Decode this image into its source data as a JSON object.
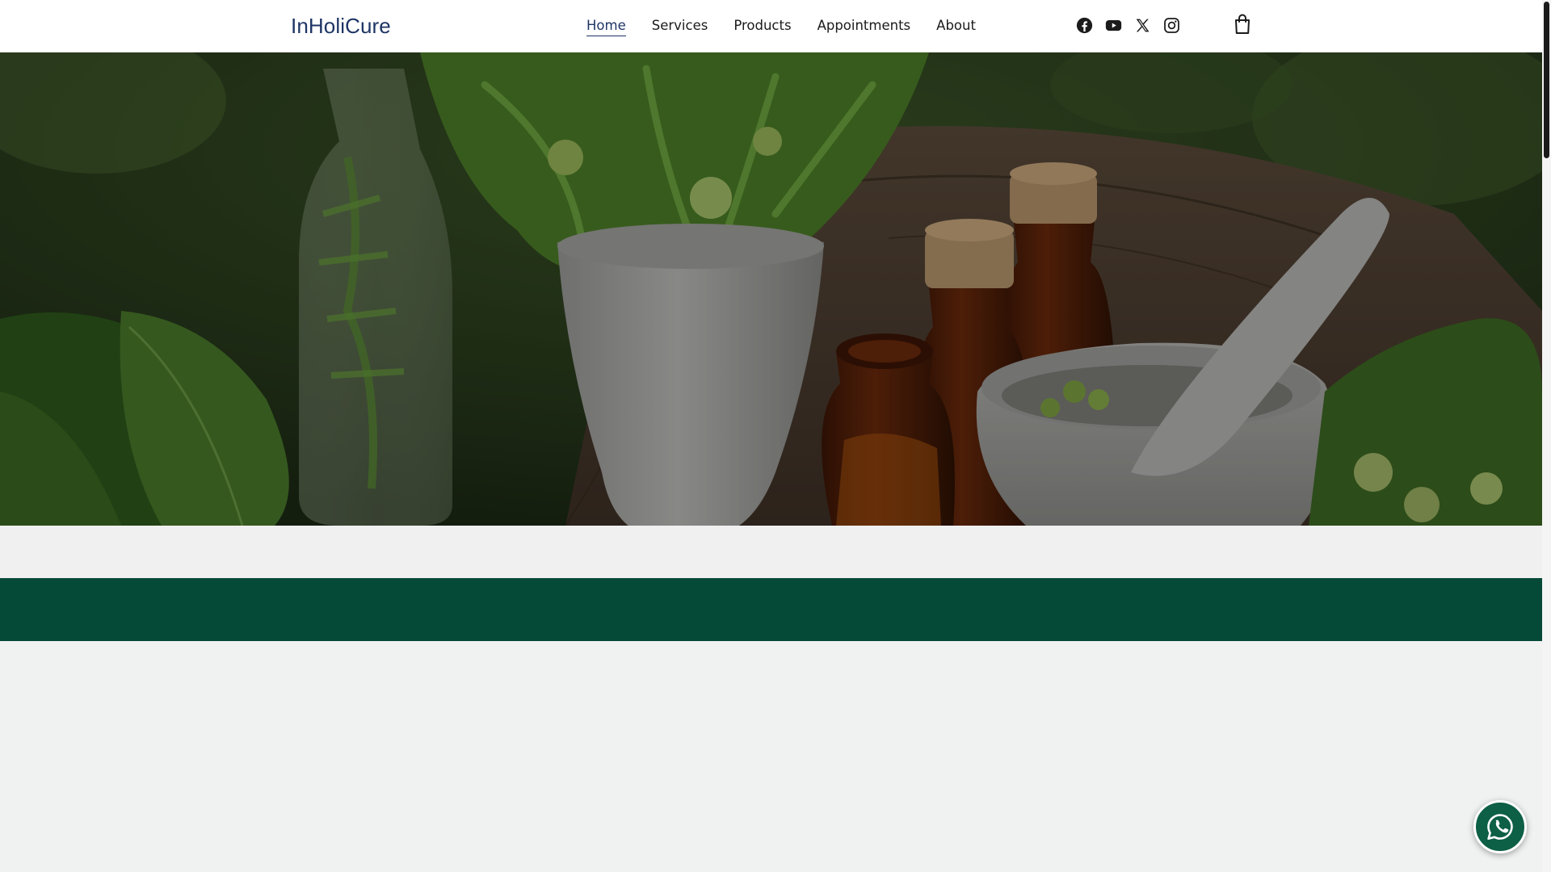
{
  "header": {
    "brand": "InHoliCure",
    "nav": [
      {
        "label": "Home",
        "active": true
      },
      {
        "label": "Services",
        "active": false
      },
      {
        "label": "Products",
        "active": false
      },
      {
        "label": "Appointments",
        "active": false
      },
      {
        "label": "About",
        "active": false
      }
    ],
    "social_icons": [
      "facebook-icon",
      "youtube-icon",
      "x-icon",
      "instagram-icon"
    ],
    "cart_icon": "shopping-bag-icon"
  },
  "hero": {
    "image": "herbal remedies photo: glass jar with fern, white cup with leaves, amber cork bottles, white mortar and pestle on wooden stump"
  },
  "floating": {
    "whatsapp_icon": "whatsapp-icon"
  },
  "colors": {
    "brand": "#1e3565",
    "band_green": "#054937",
    "whatsapp": "#0d5f45"
  }
}
